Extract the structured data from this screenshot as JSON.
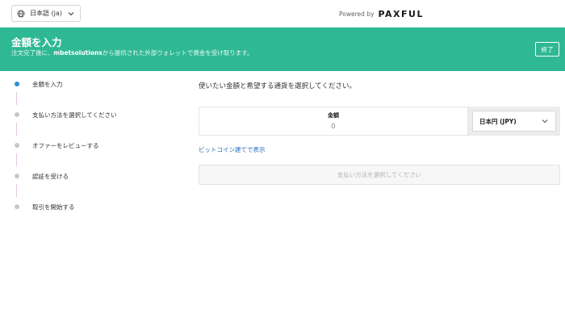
{
  "header": {
    "language_label": "日本語 (ja)",
    "powered_by": "Powered by",
    "brand": "PAXFUL"
  },
  "banner": {
    "title": "金額を入力",
    "subtitle_prefix": "注文完了後に、",
    "subtitle_merchant": "mbetsolutions",
    "subtitle_suffix": "から提供された外部ウォレットで資金を受け取ります。",
    "end_label": "終了"
  },
  "steps": [
    {
      "label": "金額を入力",
      "active": true
    },
    {
      "label": "支払い方法を選択してください",
      "active": false
    },
    {
      "label": "オファーをレビューする",
      "active": false
    },
    {
      "label": "認証を受ける",
      "active": false
    },
    {
      "label": "取引を開始する",
      "active": false
    }
  ],
  "main": {
    "prompt": "使いたい金額と希望する通貨を選択してください。",
    "amount_label": "金額",
    "amount_value": "0",
    "currency_selected": "日本円 (JPY)",
    "btc_link": "ビットコイン建てで表示",
    "payment_button": "支払い方法を選択してください"
  },
  "colors": {
    "banner": "#2fb894",
    "active_step": "#2a8fcf",
    "link": "#2a6fb8"
  }
}
